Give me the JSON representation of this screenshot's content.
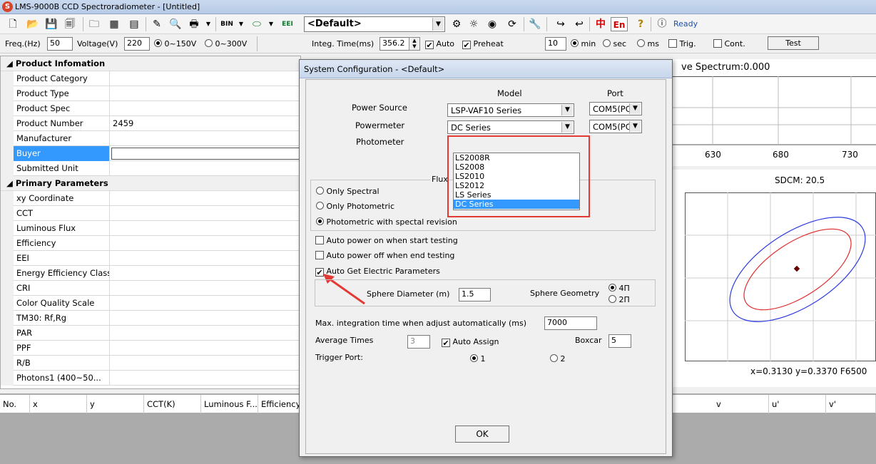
{
  "window": {
    "title": "LMS-9000B CCD Spectroradiometer - [Untitled]"
  },
  "toolbar1": {
    "profile": "<Default>",
    "status": "Ready",
    "lang_cn": "中",
    "lang_en": "En",
    "eei": "EEI",
    "bin": "BIN"
  },
  "toolbar2": {
    "freq_label": "Freq.(Hz)",
    "freq_value": "50",
    "voltage_label": "Voltage(V)",
    "voltage_value": "220",
    "range1": "0~150V",
    "range2": "0~300V",
    "integ_label": "Integ. Time(ms)",
    "integ_value": "356.2",
    "auto": "Auto",
    "preheat": "Preheat",
    "time_value": "10",
    "min": "min",
    "sec": "sec",
    "ms": "ms",
    "trig": "Trig.",
    "cont": "Cont.",
    "test": "Test"
  },
  "product_info": {
    "header": "Product Infomation",
    "rows": [
      {
        "k": "Product Category",
        "v": ""
      },
      {
        "k": "Product Type",
        "v": ""
      },
      {
        "k": "Product Spec",
        "v": ""
      },
      {
        "k": "Product Number",
        "v": "2459"
      },
      {
        "k": "Manufacturer",
        "v": ""
      },
      {
        "k": "Buyer",
        "v": ""
      },
      {
        "k": "Submitted Unit",
        "v": ""
      }
    ]
  },
  "primary_params": {
    "header": "Primary Parameters",
    "rows": [
      "xy Coordinate",
      "CCT",
      "Luminous Flux",
      "Efficiency",
      "EEI",
      "Energy Efficiency Class",
      "CRI",
      "Color Quality Scale",
      "TM30: Rf,Rg",
      "PAR",
      "PPF",
      "R/B",
      "Photons1 (400~50..."
    ]
  },
  "spectrum": {
    "title_partial": "ve Spectrum:0.000",
    "ticks": [
      "630",
      "680",
      "730"
    ]
  },
  "cie": {
    "sdcm": "SDCM:  20.5",
    "coords": "x=0.3130  y=0.3370  F6500"
  },
  "table": {
    "columns": [
      "No.",
      "x",
      "y",
      "CCT(K)",
      "Luminous F...",
      "Efficiency",
      "v",
      "u'",
      "v'"
    ]
  },
  "dialog": {
    "title": "System Configuration - <Default>",
    "model_header": "Model",
    "port_header": "Port",
    "power_source_label": "Power Source",
    "power_source_value": "LSP-VAF10 Series",
    "power_source_port": "COM5(PC",
    "powermeter_label": "Powermeter",
    "powermeter_value": "DC Series",
    "powermeter_port": "COM5(PC",
    "photometer_label": "Photometer",
    "dropdown_options": [
      "LS2008R",
      "LS2008",
      "LS2010",
      "LS2012",
      "LS Series",
      "DC Series"
    ],
    "dropdown_selected": "DC Series",
    "flux_label": "Flux",
    "mode_options": [
      "Only Spectral",
      "Only Photometric",
      "Photometric with spectal revision"
    ],
    "auto_power_on": "Auto power on when start testing",
    "auto_power_off": "Auto power off when end testing",
    "auto_electric": "Auto Get Electric Parameters",
    "sphere_diameter_label": "Sphere Diameter (m)",
    "sphere_diameter_value": "1.5",
    "sphere_geometry_label": "Sphere Geometry",
    "geom_4pi": "4Π",
    "geom_2pi": "2Π",
    "max_integ_label": "Max. integration time when adjust automatically (ms)",
    "max_integ_value": "7000",
    "avg_times_label": "Average Times",
    "avg_times_value": "3",
    "auto_assign": "Auto Assign",
    "boxcar_label": "Boxcar",
    "boxcar_value": "5",
    "trigger_label": "Trigger Port:",
    "trigger_1": "1",
    "trigger_2": "2",
    "ok": "OK"
  },
  "colors": {
    "highlight": "#3399ff",
    "annotation": "#e53935",
    "status": "#1f4ea8"
  }
}
